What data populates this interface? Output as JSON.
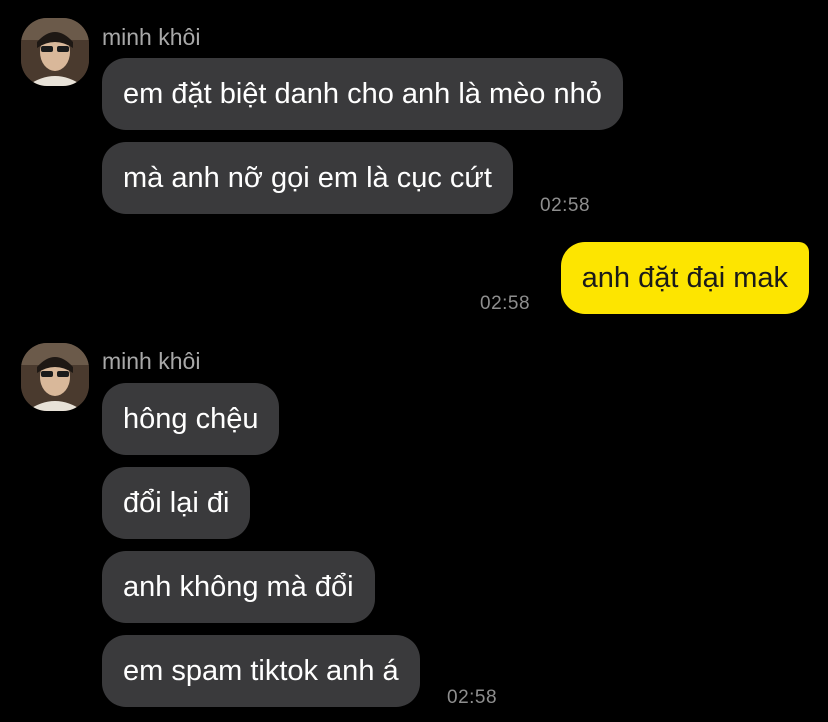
{
  "chat": {
    "groups": [
      {
        "sender": "minh khôi",
        "messages": [
          "em đặt biệt danh cho anh là mèo nhỏ",
          "mà anh nỡ gọi em là cục cứt"
        ],
        "time": "02:58"
      },
      {
        "sender": "me",
        "messages": [
          "anh đặt đại mak"
        ],
        "time": "02:58"
      },
      {
        "sender": "minh khôi",
        "messages": [
          "hông chệu",
          "đổi lại đi",
          "anh không mà đổi",
          "em spam tiktok anh á"
        ],
        "time": "02:58"
      }
    ]
  },
  "colors": {
    "background": "#000000",
    "incoming_bubble": "#3a3a3c",
    "outgoing_bubble": "#fde500",
    "sender_text": "#a8a8a8",
    "timestamp_text": "#8e8e8e"
  }
}
